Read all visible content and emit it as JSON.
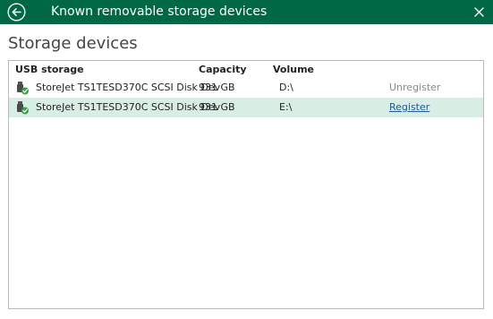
{
  "window": {
    "title": "Known removable storage devices"
  },
  "section": {
    "title": "Storage devices"
  },
  "table": {
    "columns": {
      "usb_storage": "USB storage",
      "capacity": "Capacity",
      "volume": "Volume"
    },
    "rows": [
      {
        "device": "StoreJet TS1TESD370C SCSI Disk Dev",
        "capacity": "931 GB",
        "volume": "D:\\",
        "action": "Unregister",
        "action_enabled": false,
        "selected": false,
        "icon": "usb-drive-icon"
      },
      {
        "device": "StoreJet TS1TESD370C SCSI Disk Dev",
        "capacity": "931 GB",
        "volume": "E:\\",
        "action": "Register",
        "action_enabled": true,
        "selected": true,
        "icon": "usb-drive-icon"
      }
    ]
  },
  "colors": {
    "titlebar": "#006845",
    "selected_row": "#d8eee5",
    "link": "#1a5aa8",
    "disabled_text": "#8a8a8a",
    "check_badge": "#3aa04a"
  }
}
